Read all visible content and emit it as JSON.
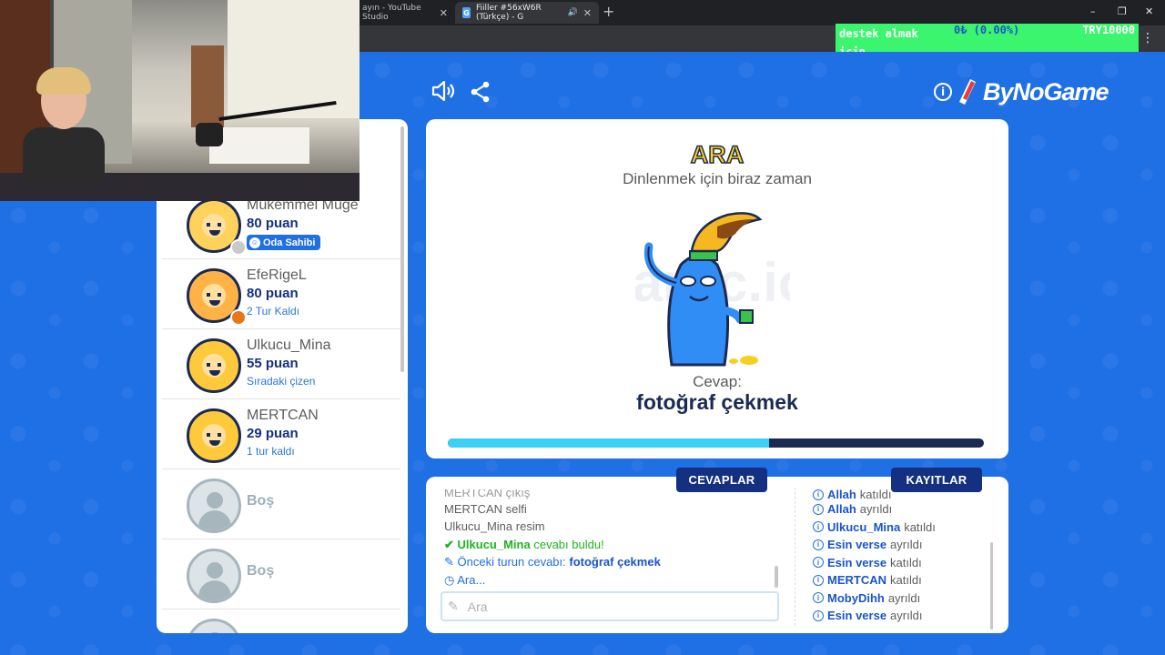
{
  "browser": {
    "tabs": [
      {
        "title": "ayın - YouTube Studio",
        "active": false
      },
      {
        "title": "Fiiller #56xW6R (Türkçe) - G",
        "active": true
      }
    ],
    "new_tab": "+",
    "window_controls": [
      "–",
      "❐",
      "✕"
    ],
    "menu": "⋮"
  },
  "ticker": {
    "label": "destek almak için",
    "change": "0₺ (0.00%)",
    "goal": "TRY10000"
  },
  "header": {
    "logo_text": "ByNoGame",
    "info_icon": "i"
  },
  "players": [
    {
      "name": "Mükemmel Müge",
      "score": "80 puan",
      "note": "",
      "owner_badge": "Oda Sahibi",
      "avatar": "blonde-glasses",
      "status_color": "#c9c9c9"
    },
    {
      "name": "EfeRigeL",
      "score": "80 puan",
      "note": "2 Tur Kaldı",
      "owner_badge": "",
      "avatar": "orange",
      "status_color": "#e8761c"
    },
    {
      "name": "Ulkucu_Mina",
      "score": "55 puan",
      "note": "Sıradaki çizen",
      "owner_badge": "",
      "avatar": "plain",
      "status_color": ""
    },
    {
      "name": "MERTCAN",
      "score": "29 puan",
      "note": "1 tur kaldı",
      "owner_badge": "",
      "avatar": "plain",
      "status_color": ""
    },
    {
      "name": "Boş",
      "score": "",
      "note": "",
      "owner_badge": "",
      "avatar": "empty",
      "status_color": ""
    },
    {
      "name": "Boş",
      "score": "",
      "note": "",
      "owner_badge": "",
      "avatar": "empty",
      "status_color": ""
    }
  ],
  "main": {
    "title": "ARA",
    "subtitle": "Dinlenmek için biraz zaman",
    "watermark": "Gartic.io",
    "answer_label": "Cevap:",
    "answer_word": "fotoğraf çekmek",
    "progress": 0.6
  },
  "tabs": {
    "answers": "CEVAPLAR",
    "logs": "KAYITLAR"
  },
  "answers_chat": {
    "cutoff_line": "MERTCAN çıkış",
    "lines": [
      {
        "user": "MERTCAN",
        "text": "selfi"
      },
      {
        "user": "Ulkucu_Mina",
        "text": "resim"
      }
    ],
    "found": {
      "user": "Ulkucu_Mina",
      "text": "cevabı buldu!"
    },
    "prev_answer": {
      "text": "Önceki turun cevabı:",
      "word": "fotoğraf çekmek"
    },
    "status": "Ara...",
    "input_placeholder": "Ara"
  },
  "logs": {
    "cutoff": {
      "user": "Allah",
      "action": "katıldı"
    },
    "lines": [
      {
        "user": "Allah",
        "action": "ayrıldı"
      },
      {
        "user": "Ulkucu_Mina",
        "action": "katıldı"
      },
      {
        "user": "Esin verse",
        "action": "ayrıldı"
      },
      {
        "user": "Esin verse",
        "action": "katıldı"
      },
      {
        "user": "MERTCAN",
        "action": "katıldı"
      },
      {
        "user": "MobyDihh",
        "action": "ayrıldı"
      },
      {
        "user": "Esin verse",
        "action": "ayrıldı"
      }
    ]
  },
  "colors": {
    "background": "#1f6fe5",
    "navy": "#1b2a52",
    "accent_blue": "#153080",
    "progress_fill": "#3ad1f5",
    "ticker_green": "#3cf56e",
    "success_green": "#1fb31f"
  }
}
